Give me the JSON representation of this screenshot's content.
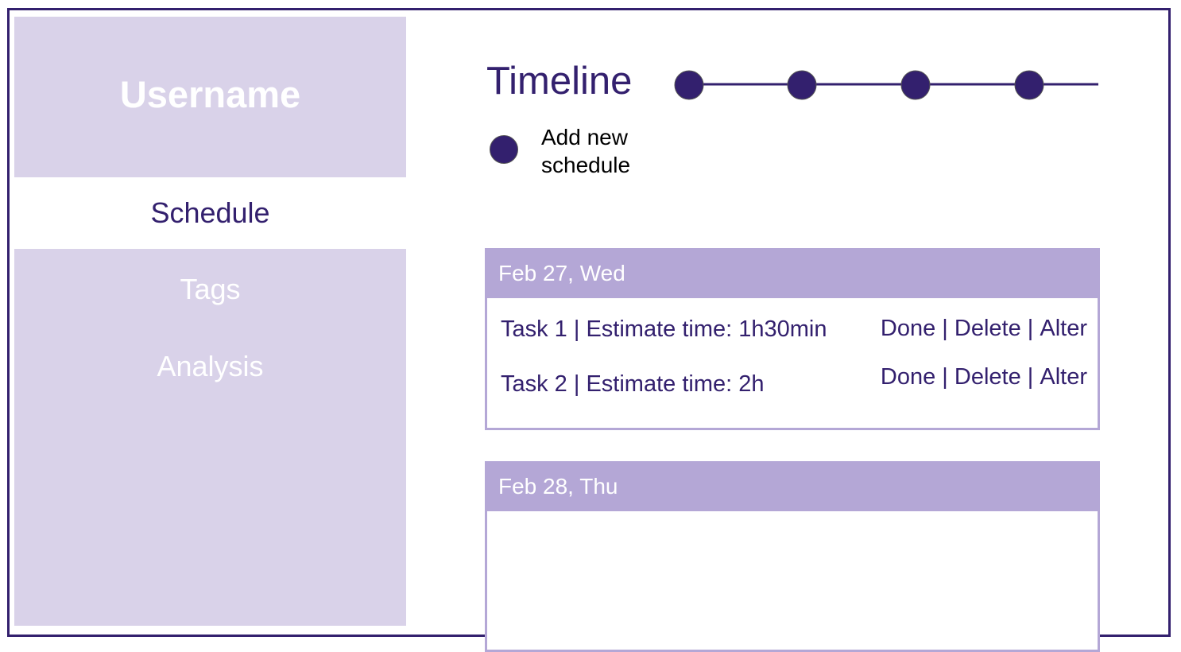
{
  "sidebar": {
    "username": "Username",
    "items": [
      {
        "label": "Schedule",
        "active": true
      },
      {
        "label": "Tags",
        "active": false
      },
      {
        "label": "Analysis",
        "active": false
      }
    ]
  },
  "timeline": {
    "title": "Timeline",
    "dot_count": 4
  },
  "add_schedule": {
    "label_line1": "Add new",
    "label_line2": "schedule"
  },
  "days": [
    {
      "date": "Feb 27, Wed",
      "tasks": [
        {
          "text": "Task 1 | Estimate time: 1h30min",
          "actions": [
            "Done",
            "Delete",
            "Alter"
          ]
        },
        {
          "text": "Task 2 | Estimate time: 2h",
          "actions": [
            "Done",
            "Delete",
            "Alter"
          ]
        }
      ]
    },
    {
      "date": "Feb 28, Thu",
      "tasks": []
    }
  ],
  "action_separator": " | ",
  "colors": {
    "accent": "#33206e",
    "sidebar_bg": "#d9d2e9",
    "card_header": "#b4a7d6"
  }
}
